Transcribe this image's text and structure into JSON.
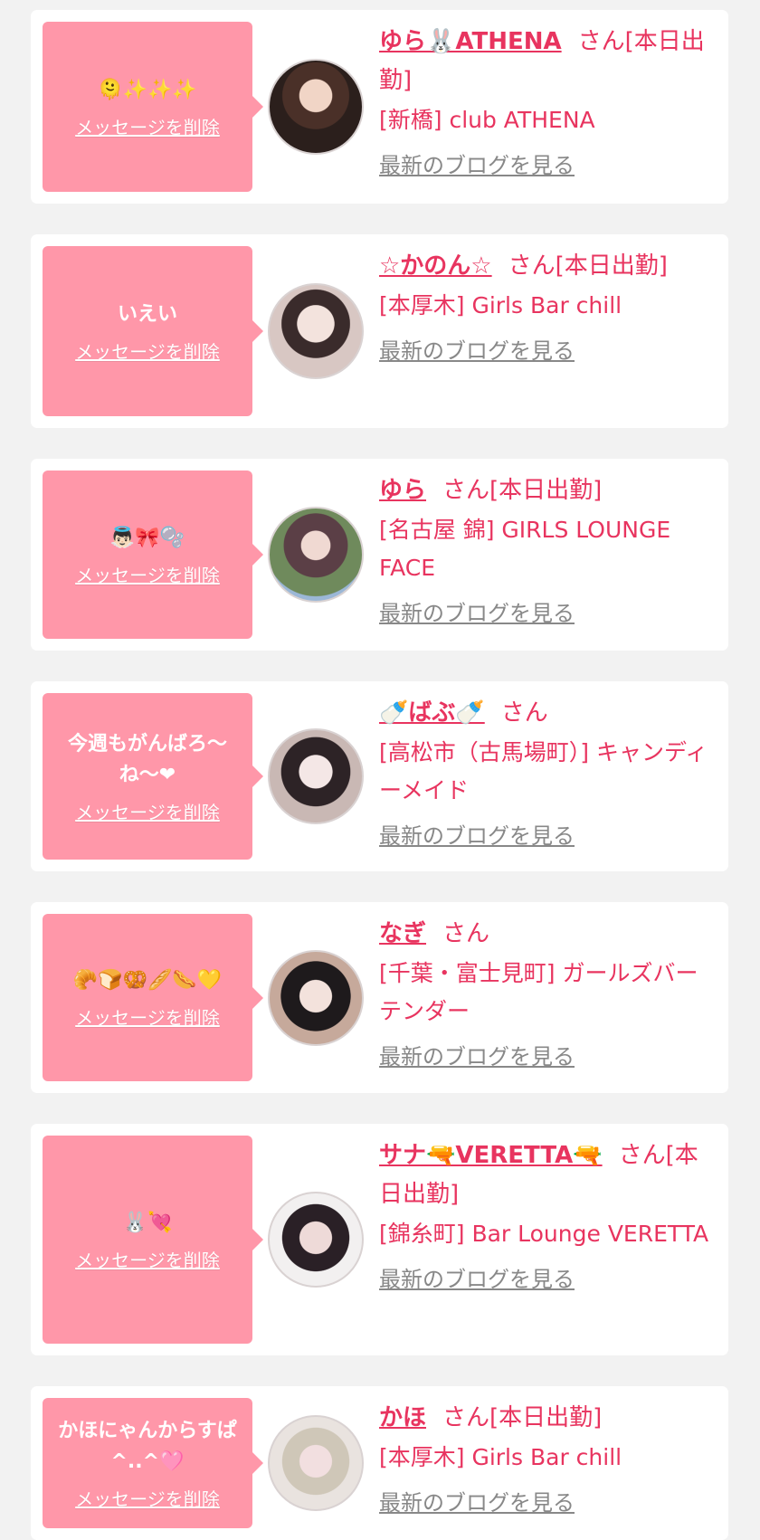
{
  "delete_label": "メッセージを削除",
  "blog_label": "最新のブログを見る",
  "honorific": "さん",
  "cards": [
    {
      "message": "🫠✨✨✨",
      "name": "ゆら🐰ATHENA",
      "status": "[本日出勤]",
      "shop": "[新橋] club ATHENA",
      "avatar_icon": "user-photo-icon"
    },
    {
      "message": "いえい",
      "name": "☆かのん☆",
      "status": "[本日出勤]",
      "shop": "[本厚木] Girls Bar chill",
      "avatar_icon": "user-photo-icon"
    },
    {
      "message": "👼🏻🎀🫧",
      "name": "ゆら",
      "status": "[本日出勤]",
      "shop": "[名古屋 錦] GIRLS LOUNGE FACE",
      "avatar_icon": "user-photo-icon"
    },
    {
      "message": "今週もがんばろ〜ね〜❤",
      "name": "🍼ばぶ🍼",
      "status": "",
      "shop": "[高松市（古馬場町）] キャンディーメイド",
      "avatar_icon": "user-photo-icon"
    },
    {
      "message": "🥐🍞🥨🥖🌭💛",
      "name": "なぎ",
      "status": "",
      "shop": "[千葉・富士見町] ガールズバー テンダー",
      "avatar_icon": "user-photo-icon"
    },
    {
      "message": "🐰💘",
      "name": "サナ🔫VERETTA🔫",
      "status": "[本日出勤]",
      "shop": "[錦糸町] Bar Lounge VERETTA",
      "avatar_icon": "user-photo-icon"
    },
    {
      "message": "かほにゃんからすぱ^..^🩷",
      "name": "かほ",
      "status": "[本日出勤]",
      "shop": "[本厚木] Girls Bar chill",
      "avatar_icon": "user-photo-icon"
    }
  ],
  "colors": {
    "bubble": "#ff97a9",
    "accent": "#e8345f",
    "link_gray": "#888888",
    "background": "#f2f2f2"
  }
}
